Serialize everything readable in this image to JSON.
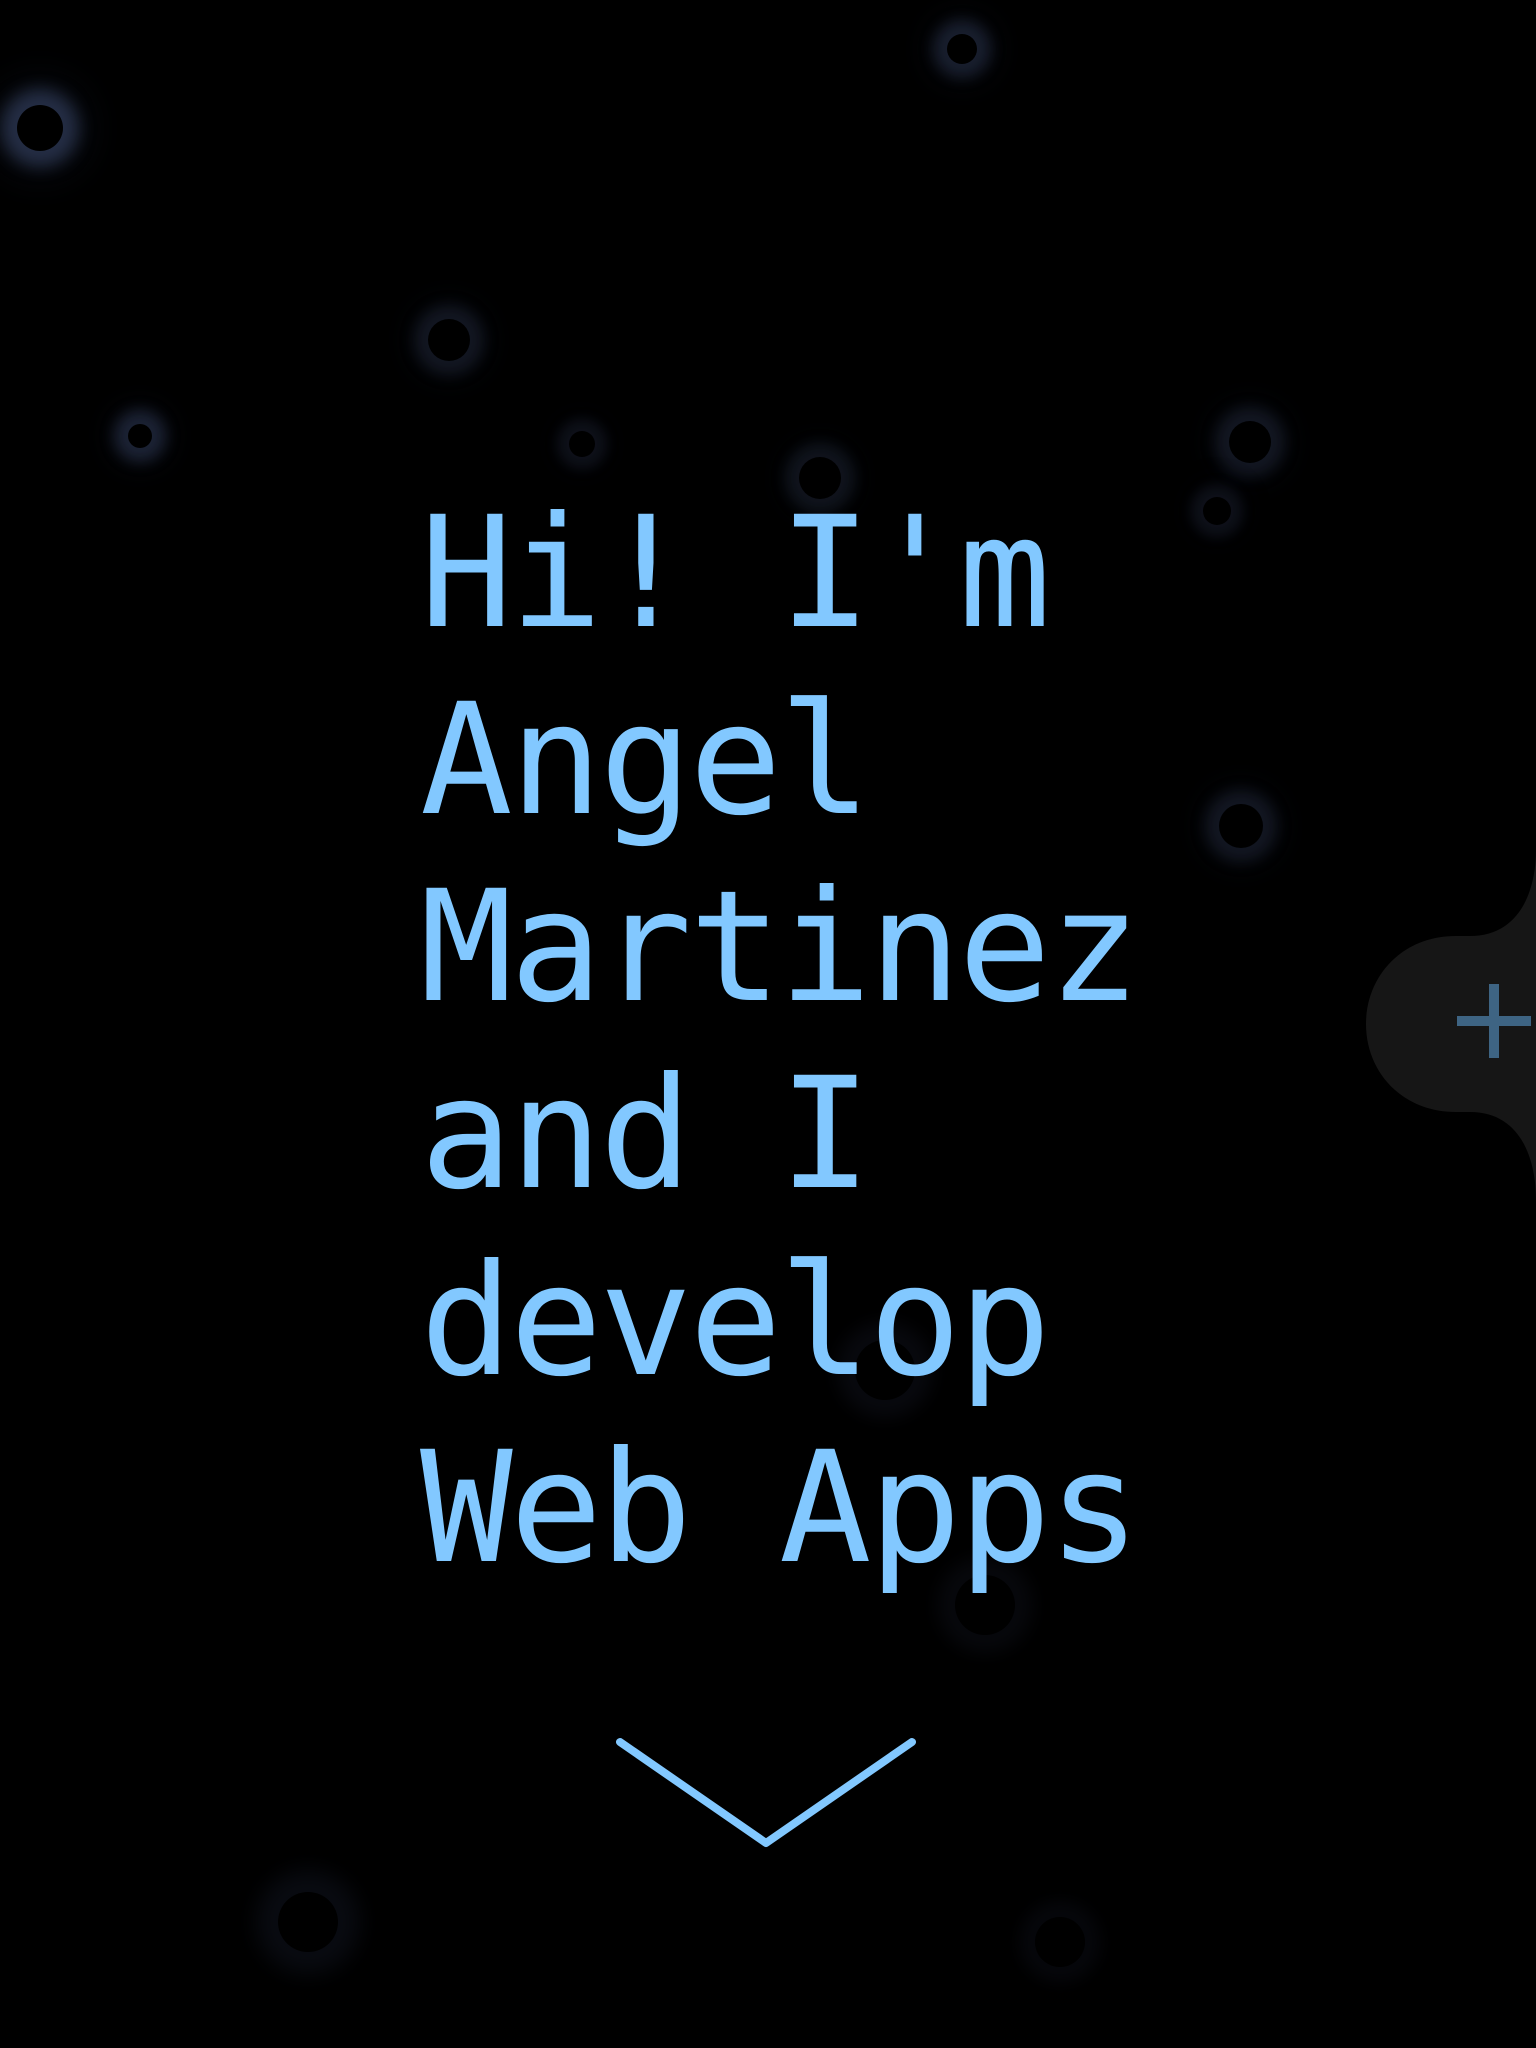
{
  "hero": {
    "lines": [
      "Hi! I'm",
      "Angel",
      "Martinez",
      "and I",
      "develop",
      "Web Apps"
    ]
  },
  "scroll_indicator": {
    "icon": "chevron-down-icon"
  },
  "side_tab": {
    "icon": "plus-icon"
  },
  "colors": {
    "background": "#000000",
    "accent": "#82c8ff",
    "orb_glow": "#3c4a70",
    "side_tab": "#161616",
    "plus": "#3e6483"
  }
}
